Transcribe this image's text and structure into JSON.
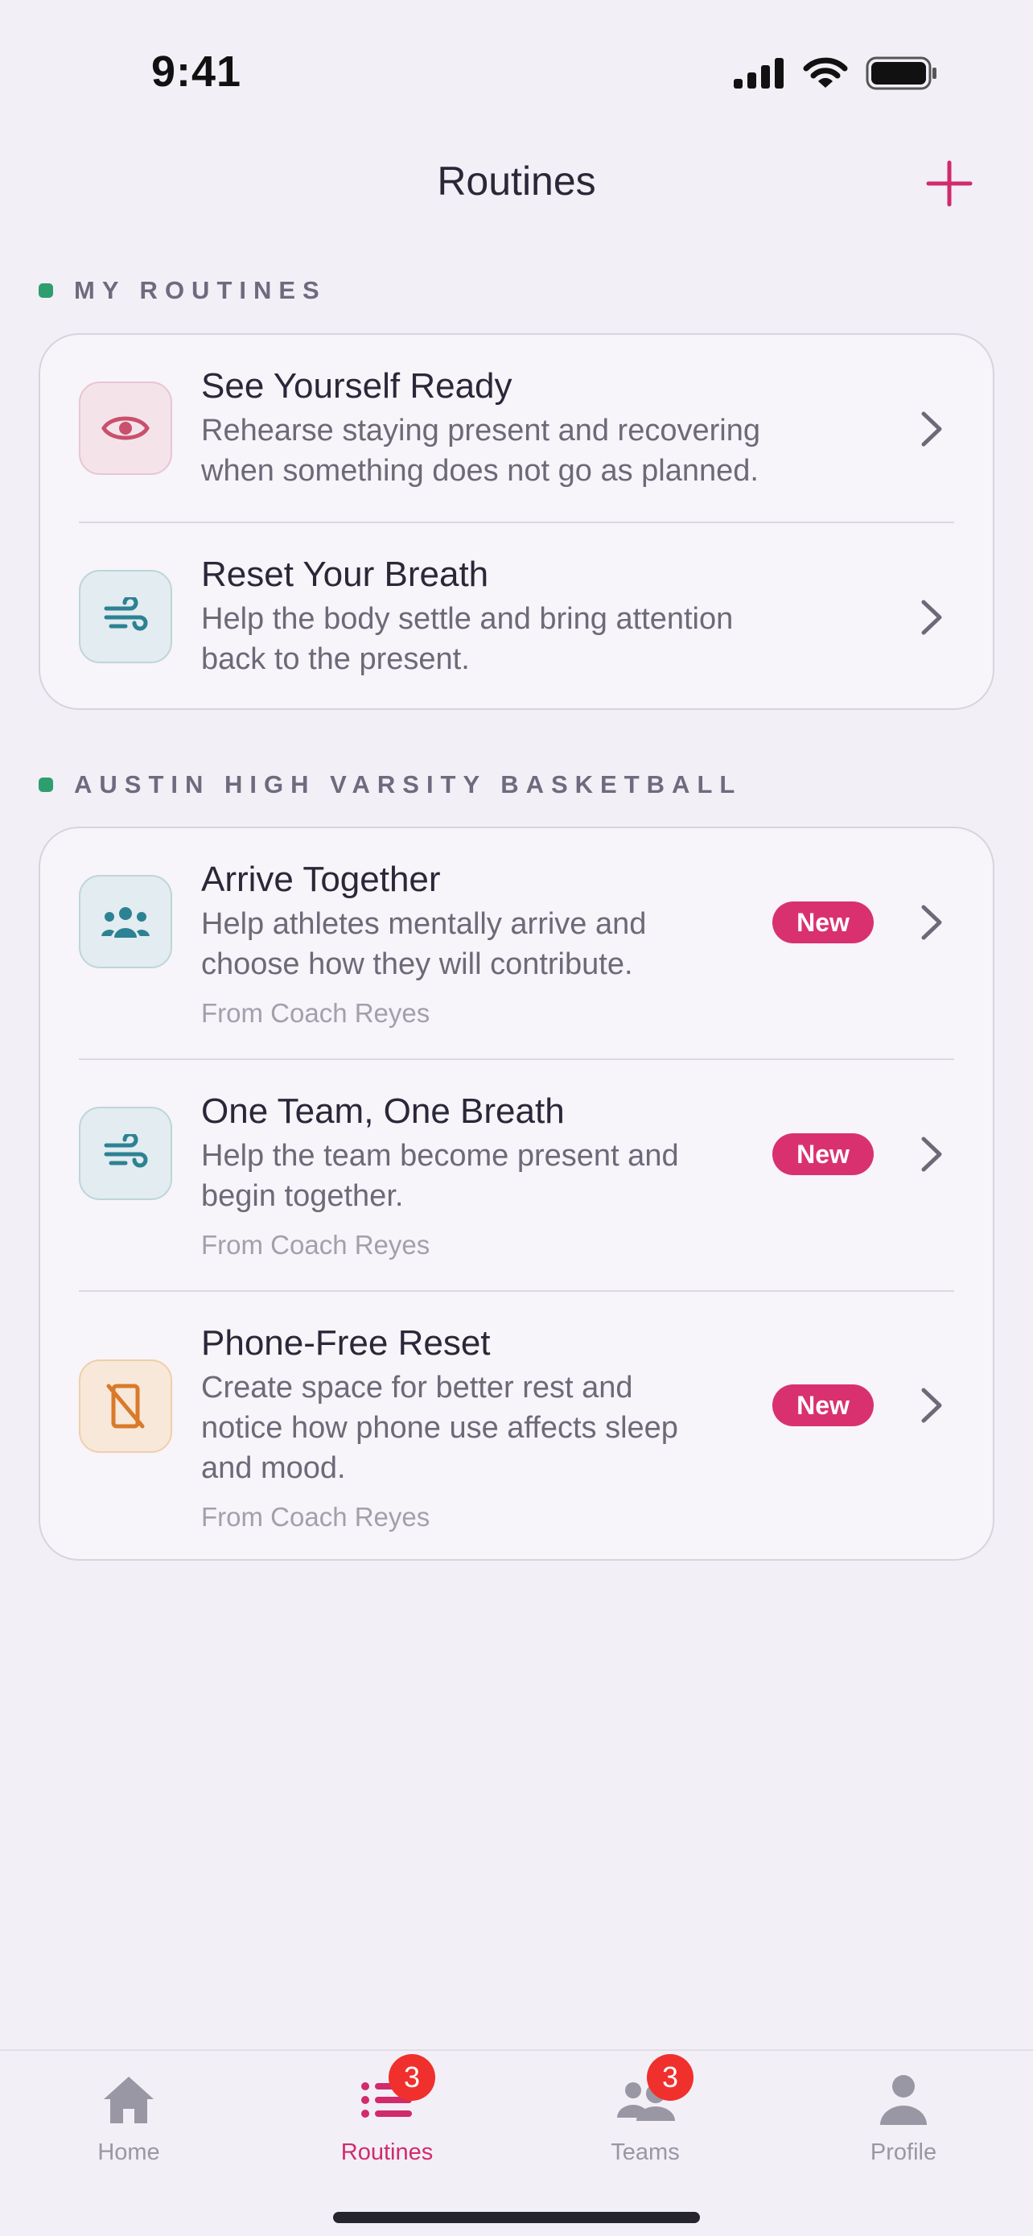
{
  "status_bar": {
    "time": "9:41"
  },
  "header": {
    "title": "Routines"
  },
  "sections": [
    {
      "label": "MY ROUTINES",
      "items": [
        {
          "title": "See Yourself Ready",
          "description_lines": [
            "Rehearse staying present and recovering",
            "when something does not go as planned."
          ],
          "icon": "eye-icon"
        },
        {
          "title": "Reset Your Breath",
          "description_lines": [
            "Help the body settle and bring attention",
            "back to the present."
          ],
          "icon": "wind-icon"
        }
      ]
    },
    {
      "label": "AUSTIN HIGH VARSITY BASKETBALL",
      "items": [
        {
          "title": "Arrive Together",
          "description_lines": [
            "Help athletes mentally arrive and",
            "choose how they will contribute."
          ],
          "source": "From Coach Reyes",
          "badge": "New",
          "icon": "group-icon"
        },
        {
          "title": "One Team, One Breath",
          "description_lines": [
            "Help the team become present and",
            "begin together."
          ],
          "source": "From Coach Reyes",
          "badge": "New",
          "icon": "wind-icon"
        },
        {
          "title": "Phone-Free Reset",
          "description_lines": [
            "Create space for better rest and",
            "notice how phone use affects sleep",
            "and mood."
          ],
          "source": "From Coach Reyes",
          "badge": "New",
          "icon": "phone-off-icon"
        }
      ]
    }
  ],
  "tab_bar": {
    "tabs": [
      {
        "label": "Home",
        "icon": "home-icon"
      },
      {
        "label": "Routines",
        "icon": "list-icon",
        "badge": "3",
        "active": true
      },
      {
        "label": "Teams",
        "icon": "people-icon",
        "badge": "3"
      },
      {
        "label": "Profile",
        "icon": "person-icon"
      }
    ]
  },
  "colors": {
    "accent": "#D9316F",
    "section_dot": "#2E9E6E",
    "badge_red": "#F0302C",
    "background": "#F2EFF7"
  }
}
